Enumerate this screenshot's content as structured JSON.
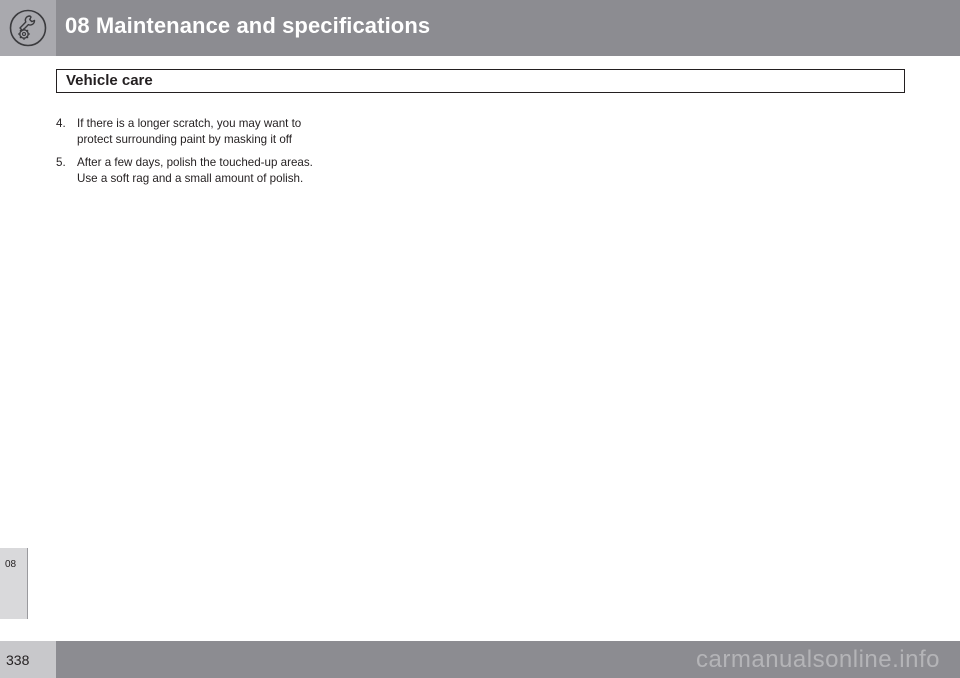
{
  "header": {
    "title": "08 Maintenance and specifications",
    "icon": "wrench-gear-icon"
  },
  "section": {
    "title": "Vehicle care"
  },
  "steps": [
    {
      "number": "4.",
      "text": "If there is a longer scratch, you may want to protect surrounding paint by masking it off"
    },
    {
      "number": "5.",
      "text": "After a few days, polish the touched-up areas. Use a soft rag and a small amount of polish."
    }
  ],
  "side_tab": {
    "label": "08"
  },
  "footer": {
    "page_number": "338",
    "watermark": "carmanualsonline.info"
  },
  "colors": {
    "header_band": "#8c8c91",
    "icon_cell": "#a9a9ae",
    "side_tab": "#d9d9db",
    "text": "#231f20"
  }
}
